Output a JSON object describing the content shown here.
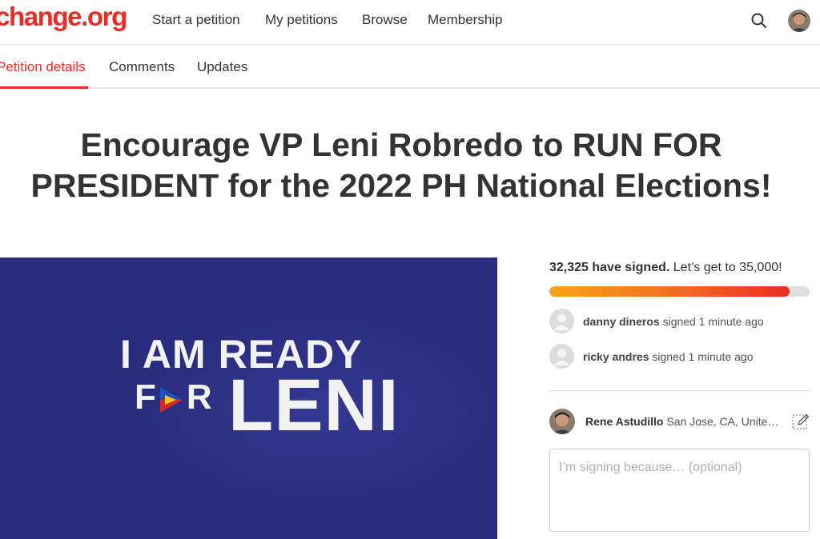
{
  "brand": {
    "logo_text": "change.org",
    "accent_color": "#ec2c22"
  },
  "nav": {
    "links": [
      "Start a petition",
      "My petitions",
      "Browse",
      "Membership"
    ],
    "search_icon": "search-icon",
    "avatar_icon": "user-avatar"
  },
  "tabs": [
    "Petition details",
    "Comments",
    "Updates"
  ],
  "petition": {
    "title": "Encourage VP Leni Robredo to RUN FOR PRESIDENT for the 2022 PH National Elections!",
    "image": {
      "line1": "I AM READY",
      "for_text_f": "F",
      "for_text_r": "R",
      "line2": "LENI",
      "background_color": "#2a2d7e"
    }
  },
  "signatures": {
    "count_text": "32,325 have signed.",
    "goal_text": "Let’s get to 35,000!",
    "progress_fraction": 0.9236,
    "recent": [
      {
        "name": "danny dineros",
        "action": "signed 1 minute ago"
      },
      {
        "name": "ricky andres",
        "action": "signed 1 minute ago"
      }
    ]
  },
  "current_user": {
    "name": "Rene Astudillo",
    "location": "San Jose, CA, United States",
    "edit_icon": "edit-icon"
  },
  "sign_form": {
    "reason_placeholder": "I’m signing because… (optional)"
  }
}
